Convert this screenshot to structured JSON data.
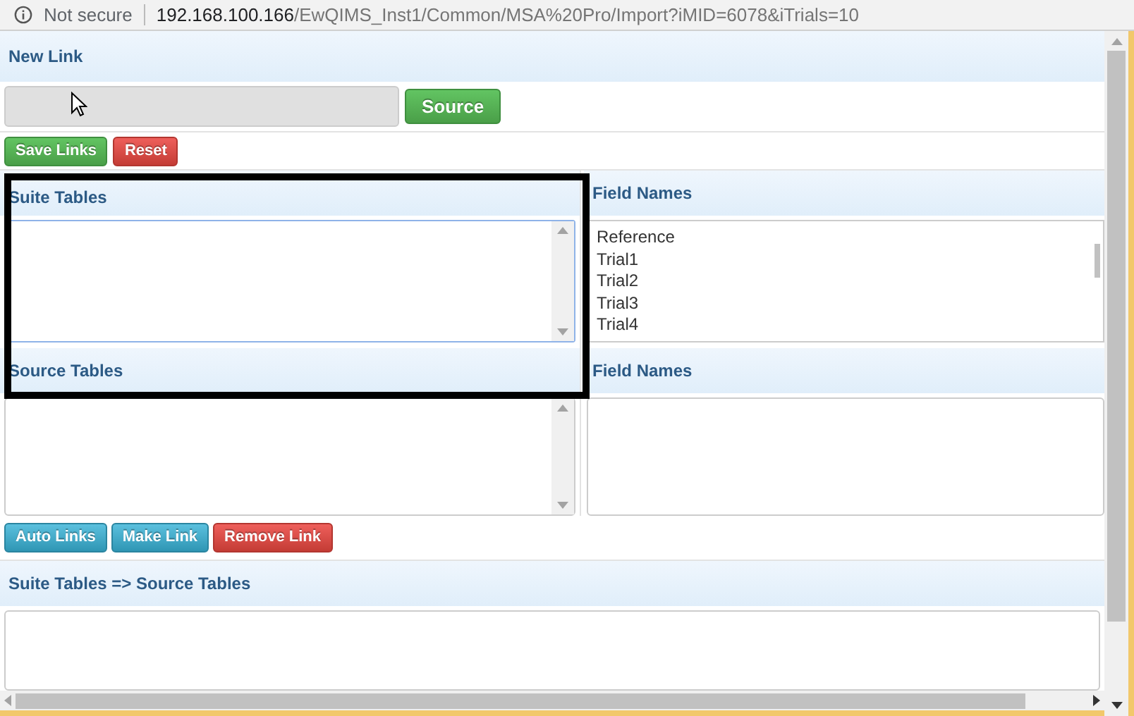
{
  "address_bar": {
    "security": "Not secure",
    "host": "192.168.100.166",
    "path": "/EwQIMS_Inst1/Common/MSA%20Pro/Import?iMID=6078&iTrials=10"
  },
  "new_link": {
    "title": "New Link",
    "source_button": "Source"
  },
  "action_buttons": [
    {
      "label": "Save Links",
      "kind": "success"
    },
    {
      "label": "Reset",
      "kind": "danger"
    }
  ],
  "suite_tables": {
    "title": "Suite Tables"
  },
  "suite_fields": {
    "title": "Field Names",
    "items": [
      "Reference",
      "Trial1",
      "Trial2",
      "Trial3",
      "Trial4"
    ]
  },
  "source_tables": {
    "title": "Source Tables"
  },
  "source_fields": {
    "title": "Field Names"
  },
  "link_buttons": [
    {
      "label": "Auto Links",
      "kind": "info"
    },
    {
      "label": "Make Link",
      "kind": "info"
    },
    {
      "label": "Remove Link",
      "kind": "danger"
    }
  ],
  "links": {
    "title": "Suite Tables => Source Tables"
  }
}
